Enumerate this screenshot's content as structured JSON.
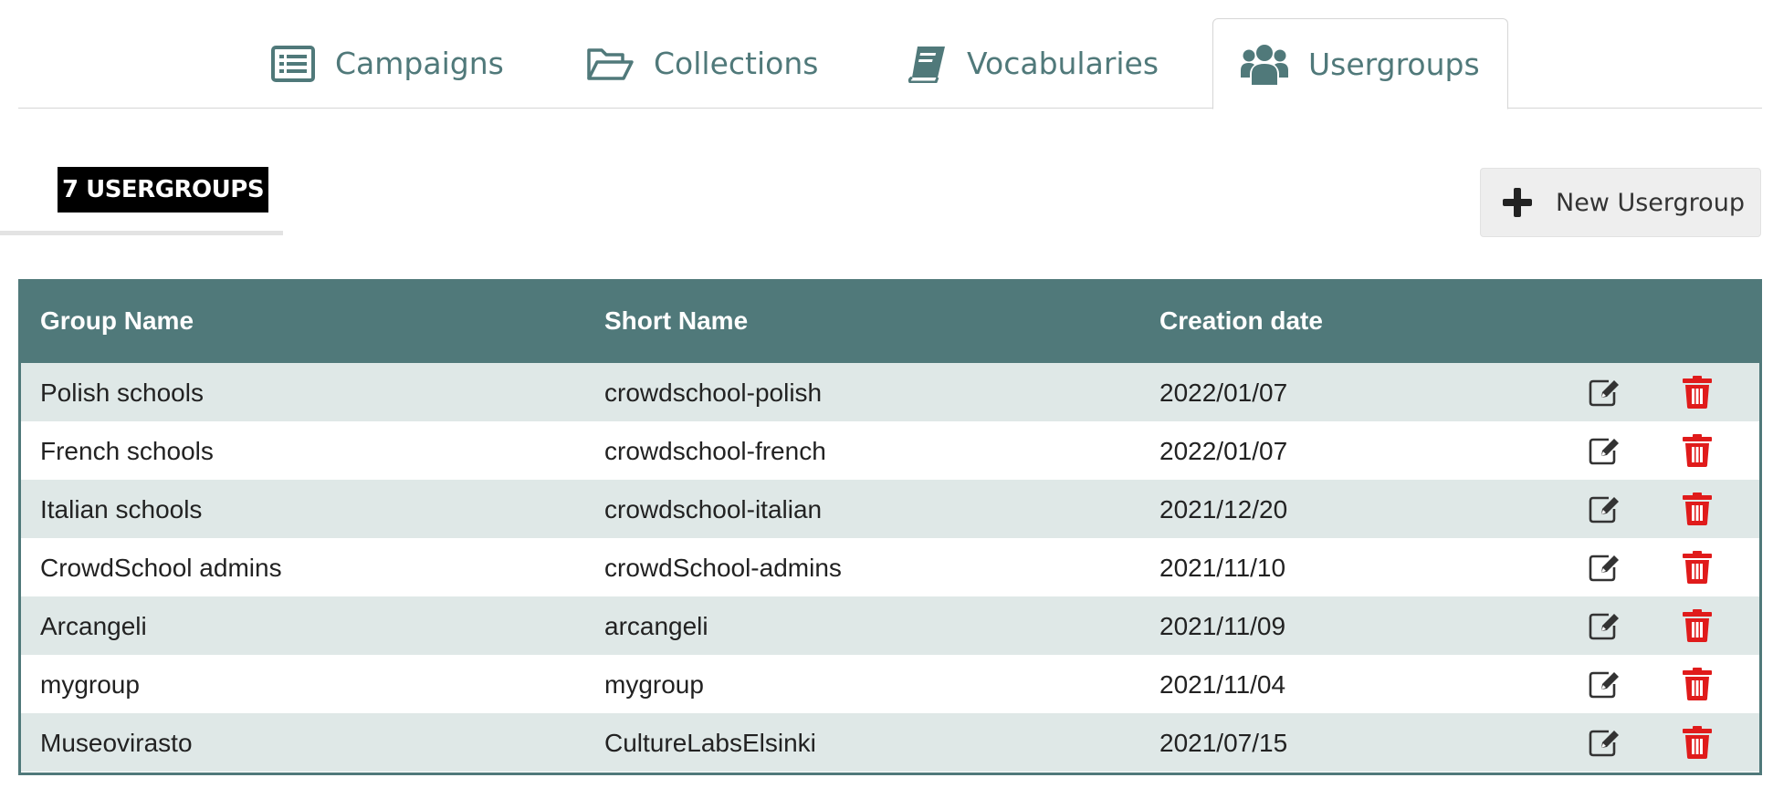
{
  "tabs": [
    {
      "label": "Campaigns",
      "icon": "list-icon"
    },
    {
      "label": "Collections",
      "icon": "folder-open-icon"
    },
    {
      "label": "Vocabularies",
      "icon": "book-icon"
    },
    {
      "label": "Usergroups",
      "icon": "users-icon",
      "active": true
    }
  ],
  "count_label": "7 USERGROUPS",
  "new_button_label": "New Usergroup",
  "table": {
    "headers": [
      "Group Name",
      "Short Name",
      "Creation date"
    ],
    "rows": [
      {
        "name": "Polish schools",
        "short": "crowdschool-polish",
        "date": "2022/01/07"
      },
      {
        "name": "French schools",
        "short": "crowdschool-french",
        "date": "2022/01/07"
      },
      {
        "name": "Italian schools",
        "short": "crowdschool-italian",
        "date": "2021/12/20"
      },
      {
        "name": "CrowdSchool admins",
        "short": "crowdSchool-admins",
        "date": "2021/11/10"
      },
      {
        "name": "Arcangeli",
        "short": "arcangeli",
        "date": "2021/11/09"
      },
      {
        "name": "mygroup",
        "short": "mygroup",
        "date": "2021/11/04"
      },
      {
        "name": "Museovirasto",
        "short": "CultureLabsElsinki",
        "date": "2021/07/15"
      }
    ]
  },
  "colors": {
    "accent": "#50797a",
    "delete": "#e01b1b",
    "row_alt": "#dfe8e7"
  }
}
